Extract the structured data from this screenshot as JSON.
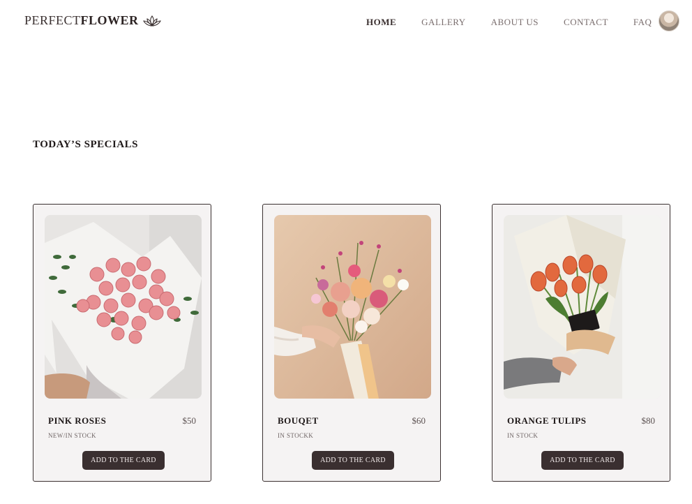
{
  "brand": {
    "name_light": "PERFECT",
    "name_bold": "FLOWER",
    "logo_icon": "lotus-icon"
  },
  "nav": {
    "items": [
      {
        "label": "HOME",
        "active": true
      },
      {
        "label": "GALLERY",
        "active": false
      },
      {
        "label": "ABOUT US",
        "active": false
      },
      {
        "label": "CONTACT",
        "active": false
      },
      {
        "label": "FAQ",
        "active": false
      }
    ]
  },
  "section": {
    "title": "TODAY’S SPECIALS"
  },
  "products": [
    {
      "name": "PINK ROSES",
      "price": "$50",
      "stock": "NEW/IN STOCK",
      "button": "ADD TO THE CARD"
    },
    {
      "name": "BOUQET",
      "price": "$60",
      "stock": "IN STOCKK",
      "button": "ADD TO THE CARD"
    },
    {
      "name": "ORANGE TULIPS",
      "price": "$80",
      "stock": "IN STOCK",
      "button": "ADD TO THE CARD"
    }
  ],
  "colors": {
    "button_bg": "#3a2f30",
    "card_bg": "#f5f3f3",
    "text_dark": "#1e1818"
  }
}
